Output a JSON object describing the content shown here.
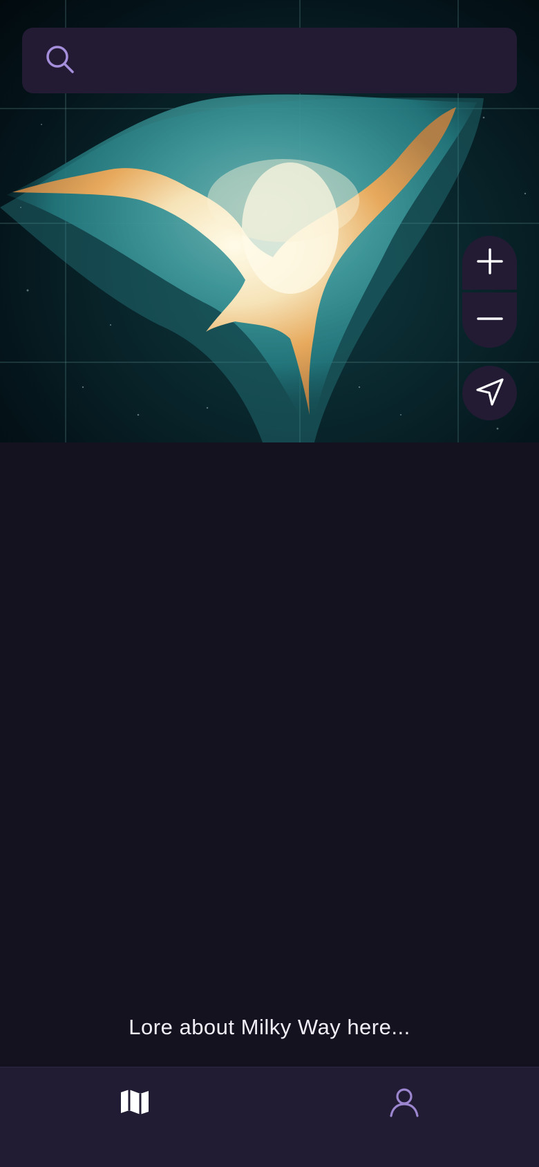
{
  "search": {
    "placeholder": "",
    "value": "",
    "icon": "search-icon"
  },
  "map": {
    "controls": {
      "zoom_in_icon": "plus-icon",
      "zoom_out_icon": "minus-icon",
      "locate_icon": "navigation-arrow-icon"
    },
    "colors": {
      "control_bg": "#221b33",
      "nebula_core": "#fff6dc",
      "nebula_orange": "#f2b365",
      "nebula_teal": "#2f8f95"
    }
  },
  "lore": {
    "text": "Lore about Milky Way here..."
  },
  "bottom_nav": {
    "items": [
      {
        "icon": "map-icon",
        "active": true
      },
      {
        "icon": "user-icon",
        "active": false
      }
    ],
    "active_color": "#ffffff",
    "inactive_color": "#9b86cf"
  }
}
